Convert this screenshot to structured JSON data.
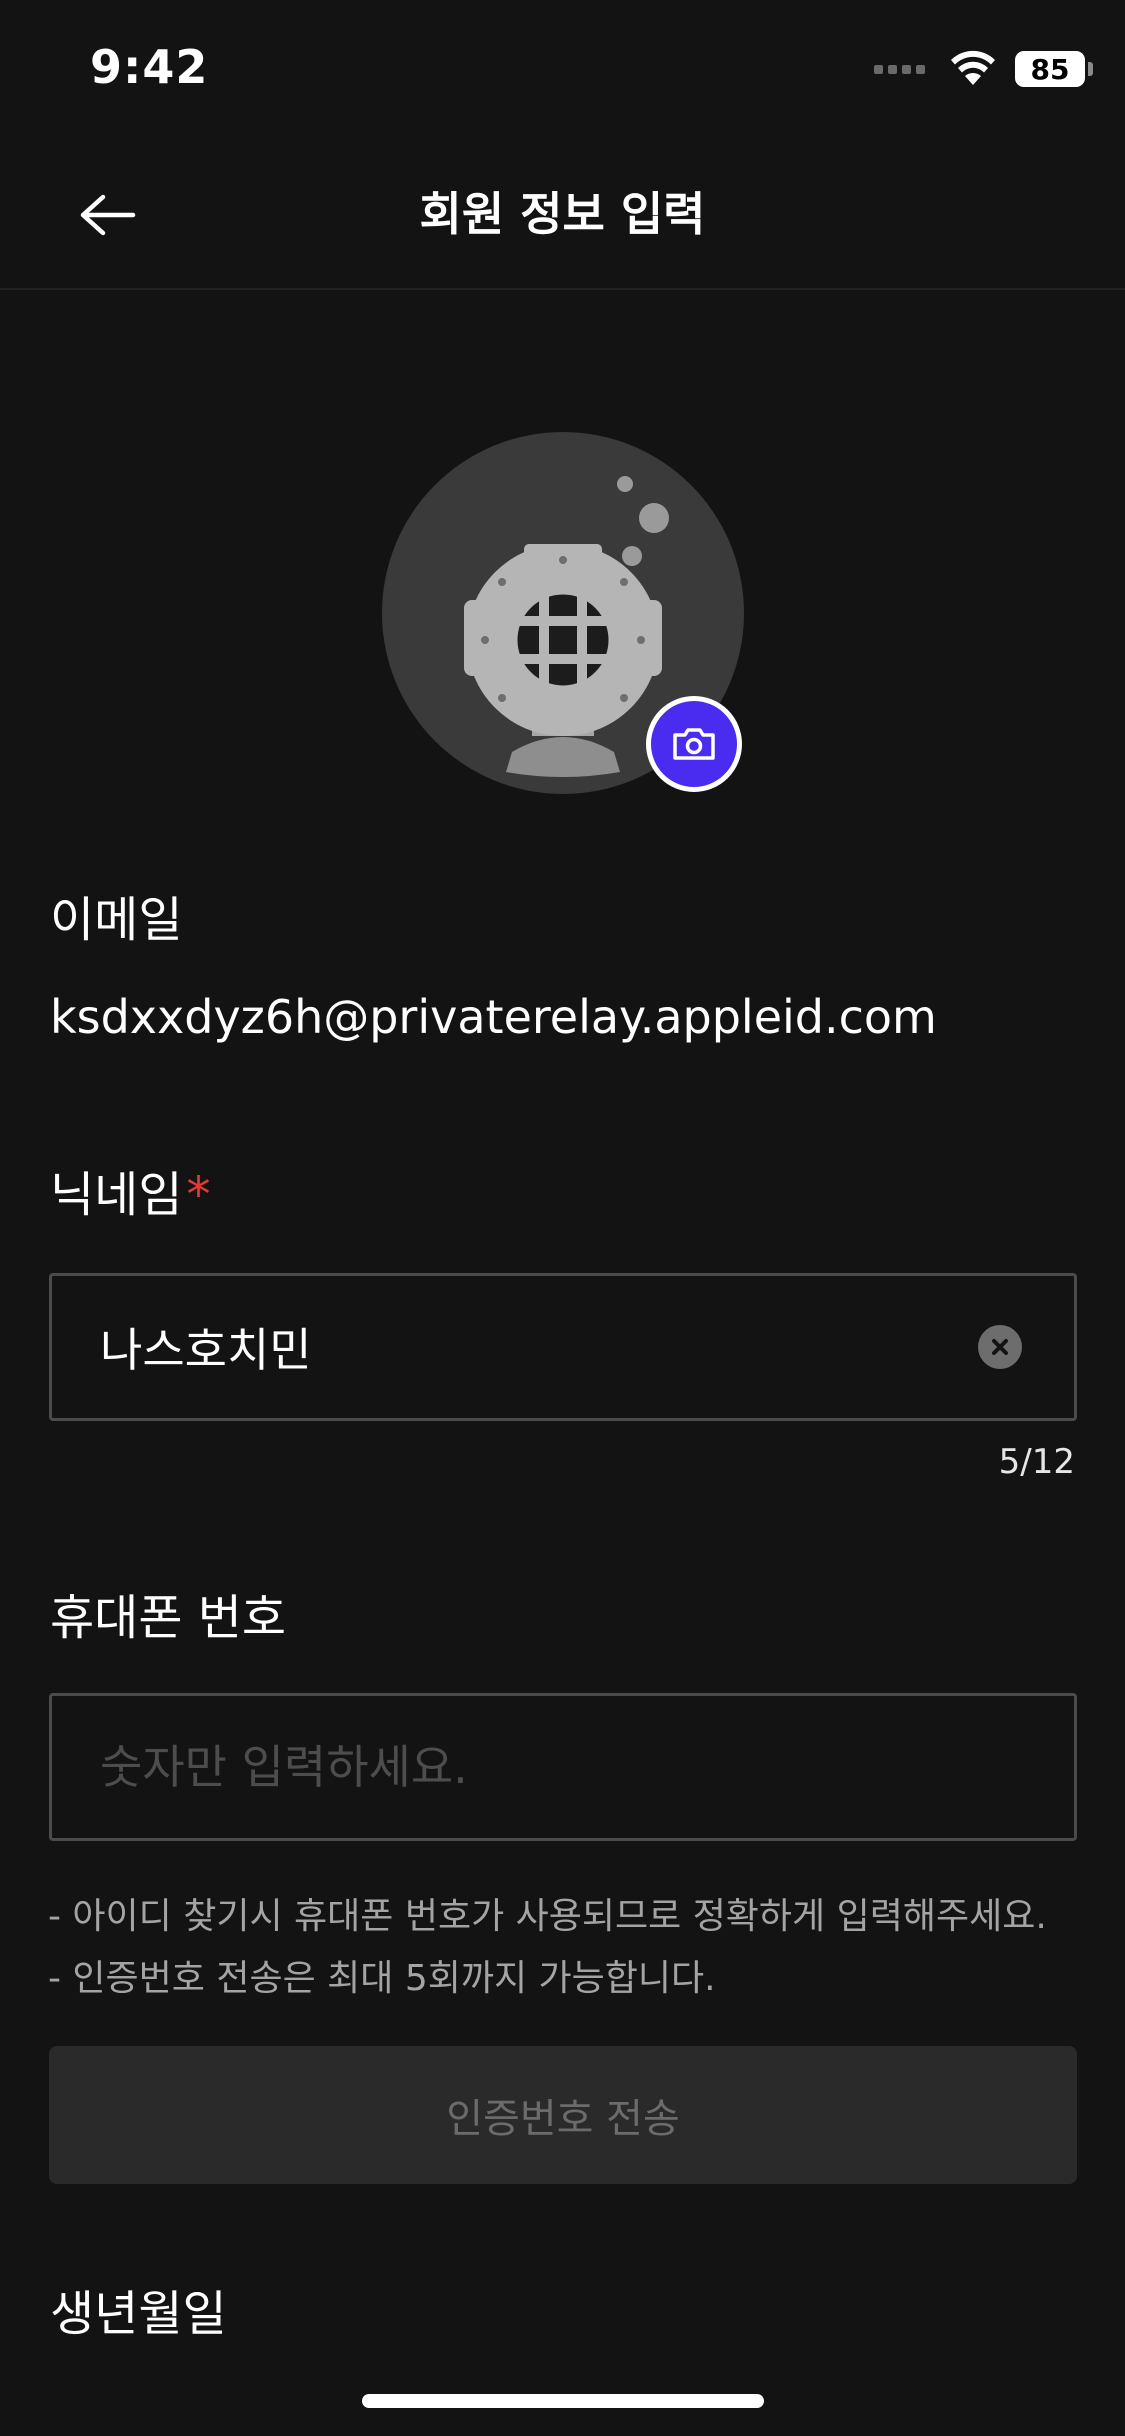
{
  "status_bar": {
    "time": "9:42",
    "battery": "85",
    "icons": [
      "signal-icon",
      "wifi-icon",
      "battery-icon"
    ]
  },
  "header": {
    "title": "회원 정보 입력",
    "back_icon": "arrow-left-icon"
  },
  "profile": {
    "avatar_icon": "diving-helmet-icon",
    "camera_icon": "camera-icon",
    "accent_color": "#4a2bf0"
  },
  "email": {
    "label": "이메일",
    "value": "ksdxxdyz6h@privaterelay.appleid.com"
  },
  "nickname": {
    "label": "닉네임",
    "required_mark": "*",
    "value": "나스호치민",
    "counter": "5/12",
    "clear_icon": "clear-icon"
  },
  "phone": {
    "label": "휴대폰 번호",
    "placeholder": "숫자만 입력하세요.",
    "help_lines": [
      "- 아이디 찾기시 휴대폰 번호가 사용되므로 정확하게 입력해주세요.",
      "- 인증번호 전송은 최대 5회까지 가능합니다."
    ],
    "send_button_label": "인증번호 전송"
  },
  "birthdate": {
    "label": "생년월일"
  },
  "colors": {
    "background": "#131313",
    "required": "#e53935"
  }
}
